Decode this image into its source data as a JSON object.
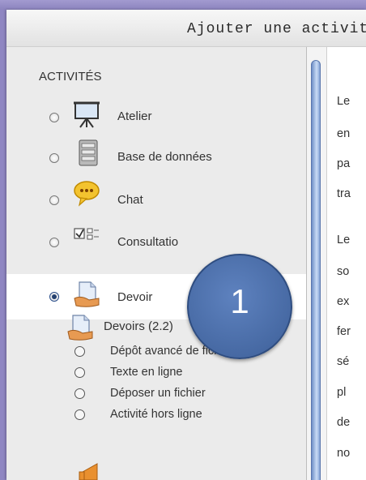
{
  "dialog": {
    "title": "Ajouter une activité"
  },
  "activities": {
    "section_title": "ACTIVITÉS",
    "items": [
      {
        "label": "Atelier",
        "icon": "easel-icon",
        "selected": false
      },
      {
        "label": "Base de données",
        "icon": "database-icon",
        "selected": false
      },
      {
        "label": "Chat",
        "icon": "chat-bubble-icon",
        "selected": false
      },
      {
        "label": "Consultatio",
        "icon": "checkbox-list-icon",
        "selected": false
      },
      {
        "label": "Devoir",
        "icon": "assignment-hand-icon",
        "selected": true
      }
    ],
    "legacy": {
      "title": "Devoirs (2.2)",
      "icon": "assignment-hand-icon",
      "items": [
        {
          "label": "Dépôt avancé de fichiers"
        },
        {
          "label": "Texte en ligne"
        },
        {
          "label": "Déposer un fichier"
        },
        {
          "label": "Activité hors ligne"
        }
      ]
    }
  },
  "description_fragments": [
    "Le",
    "en",
    "pa",
    "tra",
    "Le",
    "so",
    "ex",
    "fer",
    "sé",
    "pl",
    "de",
    "no"
  ],
  "callout": {
    "number": "1"
  }
}
